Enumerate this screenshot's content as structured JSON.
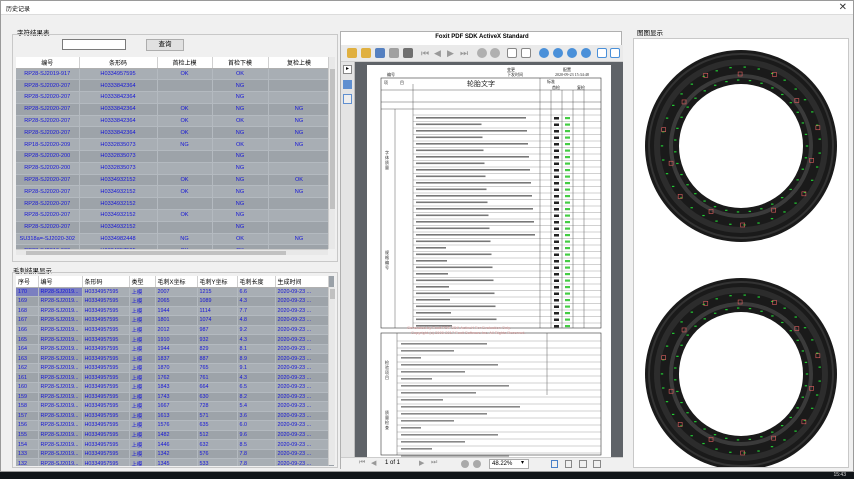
{
  "window": {
    "title": "历史记录"
  },
  "left_top": {
    "group_title": "字符结果表",
    "search_value": "",
    "search_button": "查询",
    "columns": [
      "编号",
      "条形码",
      "首检上模",
      "首检下模",
      "复检上模"
    ],
    "rows": [
      [
        "RP28-SJ2019-917",
        "H0334957595",
        "OK",
        "OK",
        ""
      ],
      [
        "RP28-SJ2020-207",
        "H0333842364",
        "",
        "NG",
        ""
      ],
      [
        "RP28-SJ2020-207",
        "H0333842364",
        "",
        "NG",
        ""
      ],
      [
        "RP28-SJ2020-207",
        "H0333842364",
        "OK",
        "NG",
        "NG"
      ],
      [
        "RP28-SJ2020-207",
        "H0333842364",
        "OK",
        "OK",
        "NG"
      ],
      [
        "RP28-SJ2020-207",
        "H0333842364",
        "OK",
        "NG",
        "NG"
      ],
      [
        "RP18-SJ2020-209",
        "H0332835073",
        "NG",
        "OK",
        "NG"
      ],
      [
        "RP28-SJ2020-200",
        "H0332835073",
        "",
        "NG",
        ""
      ],
      [
        "RP28-SJ2020-200",
        "H0332835073",
        "",
        "NG",
        ""
      ],
      [
        "RP28-SJ2020-207",
        "H0334932152",
        "OK",
        "NG",
        "OK"
      ],
      [
        "RP28-SJ2020-207",
        "H0334932152",
        "OK",
        "NG",
        "NG"
      ],
      [
        "RP28-SJ2020-207",
        "H0334932152",
        "",
        "NG",
        ""
      ],
      [
        "RP28-SJ2020-207",
        "H0334932152",
        "OK",
        "NG",
        ""
      ],
      [
        "RP28-SJ2020-207",
        "H0334932152",
        "",
        "NG",
        ""
      ],
      [
        "SU318a=-SJ2020-302",
        "H0334982448",
        "NG",
        "OK",
        "NG"
      ],
      [
        "RP28-SJ2019-909",
        "H0334957595",
        "OK",
        "OK",
        ""
      ]
    ]
  },
  "left_bottom": {
    "group_title": "毛刺结果显示",
    "columns": [
      "序号",
      "编号",
      "条形码",
      "类型",
      "毛刺X坐标",
      "毛刺Y坐标",
      "毛刺长度",
      "生成时间"
    ],
    "rows": [
      [
        "170",
        "RP28-SJ2019...",
        "H0334957595",
        "上模",
        "2007",
        "1215",
        "6.6",
        "2020-09-23 ..."
      ],
      [
        "169",
        "RP28-SJ2019...",
        "H0334957595",
        "上模",
        "2065",
        "1089",
        "4.3",
        "2020-09-23 ..."
      ],
      [
        "168",
        "RP28-SJ2019...",
        "H0334957595",
        "上模",
        "1944",
        "1114",
        "7.7",
        "2020-09-23 ..."
      ],
      [
        "167",
        "RP28-SJ2019...",
        "H0334957595",
        "上模",
        "1801",
        "1074",
        "4.8",
        "2020-09-23 ..."
      ],
      [
        "166",
        "RP28-SJ2019...",
        "H0334957595",
        "上模",
        "2012",
        "987",
        "9.2",
        "2020-09-23 ..."
      ],
      [
        "165",
        "RP28-SJ2019...",
        "H0334957595",
        "上模",
        "1910",
        "932",
        "4.3",
        "2020-09-23 ..."
      ],
      [
        "164",
        "RP28-SJ2019...",
        "H0334957595",
        "上模",
        "1944",
        "829",
        "8.1",
        "2020-09-23 ..."
      ],
      [
        "163",
        "RP28-SJ2019...",
        "H0334957595",
        "上模",
        "1837",
        "887",
        "8.9",
        "2020-09-23 ..."
      ],
      [
        "162",
        "RP28-SJ2019...",
        "H0334957595",
        "上模",
        "1870",
        "765",
        "9.1",
        "2020-09-23 ..."
      ],
      [
        "161",
        "RP28-SJ2019...",
        "H0334957595",
        "上模",
        "1762",
        "761",
        "4.3",
        "2020-09-23 ..."
      ],
      [
        "160",
        "RP28-SJ2019...",
        "H0334957595",
        "上模",
        "1843",
        "664",
        "6.5",
        "2020-09-23 ..."
      ],
      [
        "159",
        "RP28-SJ2019...",
        "H0334957595",
        "上模",
        "1743",
        "630",
        "8.2",
        "2020-09-23 ..."
      ],
      [
        "158",
        "RP28-SJ2019...",
        "H0334957595",
        "上模",
        "1667",
        "728",
        "5.4",
        "2020-09-23 ..."
      ],
      [
        "157",
        "RP28-SJ2019...",
        "H0334957595",
        "上模",
        "1613",
        "571",
        "3.6",
        "2020-09-23 ..."
      ],
      [
        "156",
        "RP28-SJ2019...",
        "H0334957595",
        "上模",
        "1576",
        "635",
        "6.0",
        "2020-09-23 ..."
      ],
      [
        "155",
        "RP28-SJ2019...",
        "H0334957595",
        "上模",
        "1482",
        "512",
        "9.6",
        "2020-09-23 ..."
      ],
      [
        "154",
        "RP28-SJ2019...",
        "H0334957595",
        "上模",
        "1446",
        "632",
        "8.5",
        "2020-09-23 ..."
      ],
      [
        "133",
        "RP28-SJ2019...",
        "H0334957595",
        "上模",
        "1342",
        "576",
        "7.8",
        "2020-09-23 ..."
      ],
      [
        "132",
        "RP28-SJ2019...",
        "H0334957595",
        "上模",
        "1345",
        "533",
        "7.8",
        "2020-09-23 ..."
      ]
    ]
  },
  "pdf": {
    "title": "Foxit PDF SDK ActiveX Standard",
    "page_indicator": "1 of 1",
    "zoom": "48.22%",
    "doc_header": [
      "变更",
      "配置",
      "编号",
      "下发时间",
      "2020-09-23 15:34:48"
    ],
    "doc_heading": "轮胎文字",
    "watermark_1": "Generated by Foxit PDF SDK ActiveX For Evaluation Only.",
    "watermark_2": "Copyright (c) 2000-2017 Foxit Software Inc. All Rights Reserved.",
    "section_labels": [
      "项",
      "目",
      "标准",
      "首检",
      "复检"
    ],
    "side_labels": [
      "字体质量",
      "规格编号",
      "检验项目",
      "质量检查",
      "检验记录"
    ]
  },
  "right": {
    "group_title": "图图显示"
  },
  "taskbar": {
    "clock": "15:43"
  },
  "colors": {
    "grid_bg": "#a8aeb4",
    "grid_text": "#1414d8",
    "selection": "#7b7fc0",
    "tire_marks": "#22cc33"
  }
}
